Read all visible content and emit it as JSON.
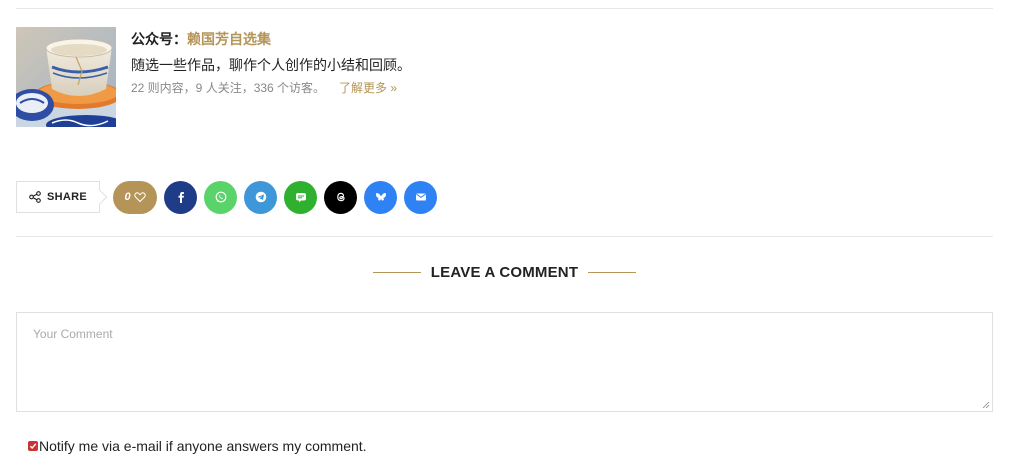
{
  "author": {
    "prefix": "公众号：",
    "name": "赖国芳自选集",
    "description": "随选一些作品，聊作个人创作的小结和回顾。",
    "stats": "22 则内容，9 人关注，336 个访客。",
    "more_link": "了解更多 »",
    "image_alt": "thumbnail-teacup"
  },
  "share": {
    "label": "SHARE",
    "like_count": "0",
    "buttons": [
      {
        "name": "facebook",
        "color": "#1f3c88",
        "icon": "facebook-icon"
      },
      {
        "name": "whatsapp",
        "color": "#59d36a",
        "icon": "whatsapp-icon"
      },
      {
        "name": "telegram",
        "color": "#3d97d8",
        "icon": "telegram-icon"
      },
      {
        "name": "line",
        "color": "#2fb02f",
        "icon": "line-icon"
      },
      {
        "name": "threads",
        "color": "#000000",
        "icon": "threads-icon"
      },
      {
        "name": "bluesky",
        "color": "#2e82f4",
        "icon": "bluesky-icon"
      },
      {
        "name": "email",
        "color": "#2e82f4",
        "icon": "email-icon"
      }
    ]
  },
  "comment": {
    "heading": "LEAVE A COMMENT",
    "placeholder": "Your Comment",
    "notify_label": "Notify me via e-mail if anyone answers my comment.",
    "notify_checked": true
  },
  "colors": {
    "accent": "#b49457",
    "border": "#e0e0e0"
  }
}
